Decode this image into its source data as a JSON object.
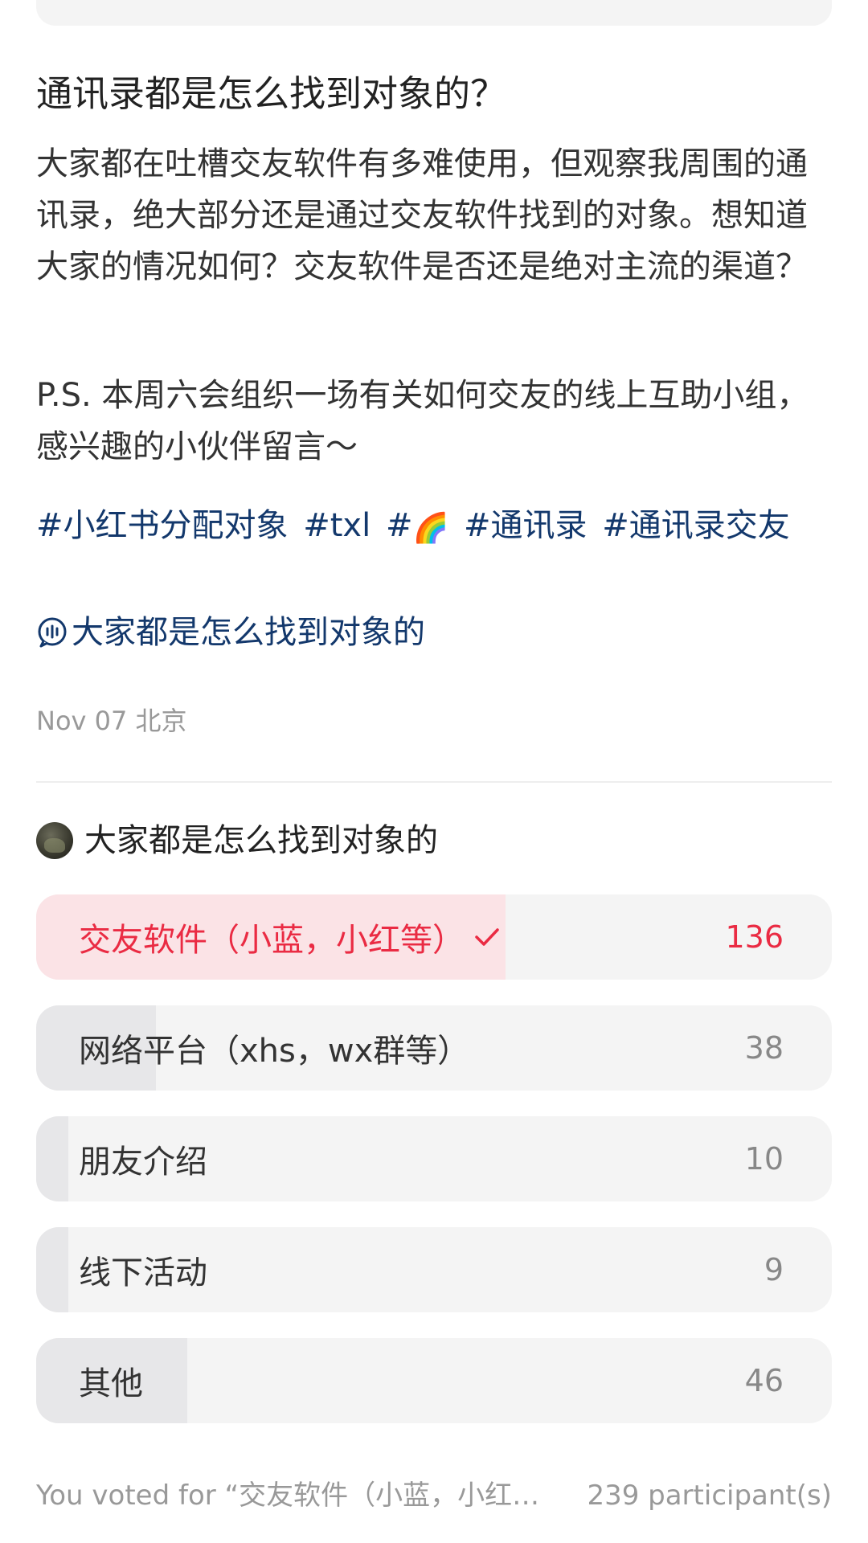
{
  "post": {
    "title": "通讯录都是怎么找到对象的？",
    "body_paragraph_1": "大家都在吐槽交友软件有多难使用，但观察我周围的通讯录，绝大部分还是通过交友软件找到的对象。想知道大家的情况如何？交友软件是否还是绝对主流的渠道？",
    "body_paragraph_2": "P.S. 本周六会组织一场有关如何交友的线上互助小组，感兴趣的小伙伴留言～",
    "tags": [
      "#小红书分配对象",
      "#txl",
      "#",
      "#通讯录",
      "#通讯录交友"
    ],
    "rainbow_emoji": "🌈",
    "topic": "大家都是怎么找到对象的",
    "date": "Nov 07",
    "location": "北京"
  },
  "poll": {
    "title": "大家都是怎么找到对象的",
    "options": [
      {
        "label": "交友软件（小蓝，小红等）",
        "count": "136",
        "share": 0.59,
        "selected": true
      },
      {
        "label": "网络平台（xhs，wx群等）",
        "count": "38",
        "share": 0.15,
        "selected": false
      },
      {
        "label": "朋友介绍",
        "count": "10",
        "share": 0.04,
        "selected": false
      },
      {
        "label": "线下活动",
        "count": "9",
        "share": 0.04,
        "selected": false
      },
      {
        "label": "其他",
        "count": "46",
        "share": 0.19,
        "selected": false
      }
    ],
    "voted_text": "You voted for “交友软件（小蓝，小红…",
    "participants": "239 participant(s)"
  },
  "colors": {
    "accent_red": "#ea2b43",
    "selected_fill": "#fbe3e6",
    "tag_blue": "#13386c"
  }
}
